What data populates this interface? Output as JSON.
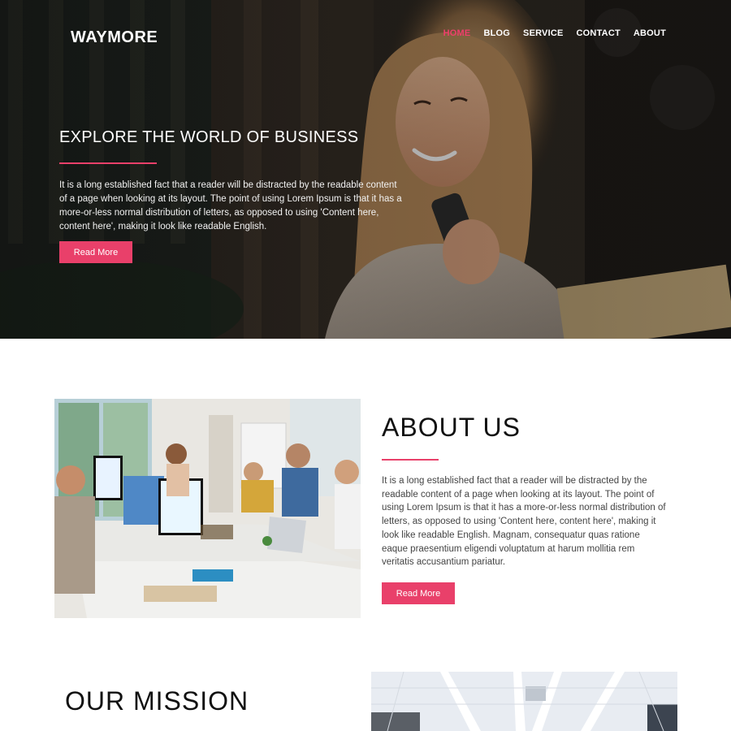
{
  "brand": {
    "name": "WAYMORE"
  },
  "nav": {
    "items": [
      {
        "label": "HOME",
        "active": true
      },
      {
        "label": "BLOG",
        "active": false
      },
      {
        "label": "SERVICE",
        "active": false
      },
      {
        "label": "CONTACT",
        "active": false
      },
      {
        "label": "ABOUT",
        "active": false
      }
    ]
  },
  "hero": {
    "title": "EXPLORE THE WORLD OF BUSINESS",
    "text": "It is a long established fact that a reader will be distracted by the readable content of a page when looking at its layout. The point of using Lorem Ipsum is that it has a more-or-less normal distribution of letters, as opposed to using 'Content here, content here', making it look like readable English.",
    "button_label": "Read More"
  },
  "about": {
    "title": "ABOUT US",
    "text": "It is a long established fact that a reader will be distracted by the readable content of a page when looking at its layout. The point of using Lorem Ipsum is that it has a more-or-less normal distribution of letters, as opposed to using 'Content here, content here', making it look like readable English. Magnam, consequatur quas ratione eaque praesentium eligendi voluptatum at harum mollitia rem veritatis accusantium pariatur.",
    "button_label": "Read More"
  },
  "mission": {
    "title": "OUR MISSION"
  },
  "colors": {
    "accent": "#e9406a",
    "nav_active": "#ef3f6b"
  }
}
